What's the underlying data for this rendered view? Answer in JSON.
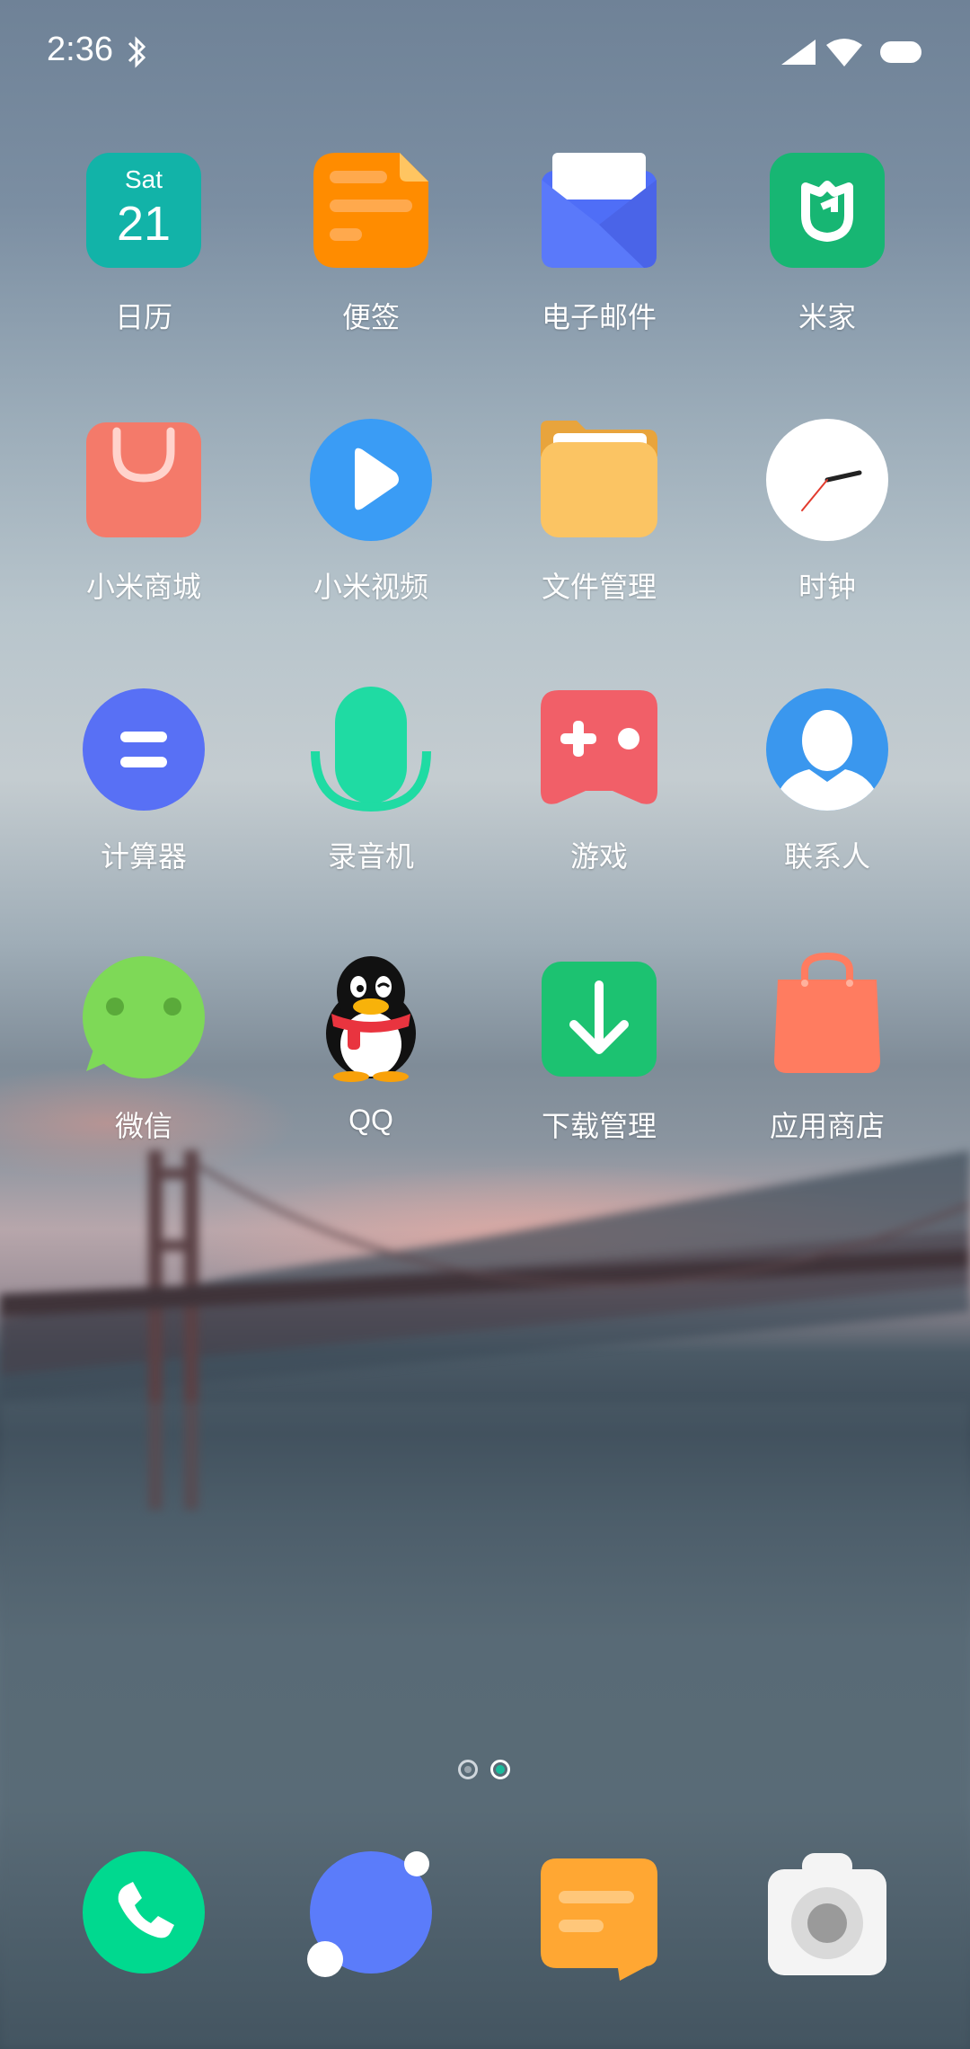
{
  "status": {
    "time": "2:36"
  },
  "apps": {
    "row1": [
      {
        "label": "日历",
        "icon": "calendar-icon",
        "day": "Sat",
        "date": "21"
      },
      {
        "label": "便签",
        "icon": "notes-icon"
      },
      {
        "label": "电子邮件",
        "icon": "email-icon"
      },
      {
        "label": "米家",
        "icon": "mi-home-icon"
      }
    ],
    "row2": [
      {
        "label": "小米商城",
        "icon": "mi-store-icon"
      },
      {
        "label": "小米视频",
        "icon": "mi-video-icon"
      },
      {
        "label": "文件管理",
        "icon": "file-manager-icon"
      },
      {
        "label": "时钟",
        "icon": "clock-icon"
      }
    ],
    "row3": [
      {
        "label": "计算器",
        "icon": "calculator-icon"
      },
      {
        "label": "录音机",
        "icon": "recorder-icon"
      },
      {
        "label": "游戏",
        "icon": "games-icon"
      },
      {
        "label": "联系人",
        "icon": "contacts-icon"
      }
    ],
    "row4": [
      {
        "label": "微信",
        "icon": "wechat-icon"
      },
      {
        "label": "QQ",
        "icon": "qq-icon"
      },
      {
        "label": "下载管理",
        "icon": "downloads-icon"
      },
      {
        "label": "应用商店",
        "icon": "app-store-icon"
      }
    ]
  },
  "dock": [
    {
      "icon": "phone-icon"
    },
    {
      "icon": "browser-icon"
    },
    {
      "icon": "messages-icon"
    },
    {
      "icon": "camera-icon"
    }
  ],
  "pager": {
    "pages": 2,
    "current": 2
  },
  "colors": {
    "calendar": "#12b3a8",
    "notes": "#ff8c00",
    "email": "#4f6ef7",
    "mihome": "#17b673",
    "store": "#f47a6a",
    "video": "#3a9cf5",
    "files": "#fbc463",
    "calculator": "#5870f5",
    "recorder": "#1fdba3",
    "games": "#f15f68",
    "contacts": "#3a97ee",
    "wechat": "#7ed957",
    "downloads": "#1cc271",
    "appstore": "#ff7c60",
    "phone": "#00d98f",
    "browser": "#5b7cfa",
    "messages": "#ffa733"
  }
}
